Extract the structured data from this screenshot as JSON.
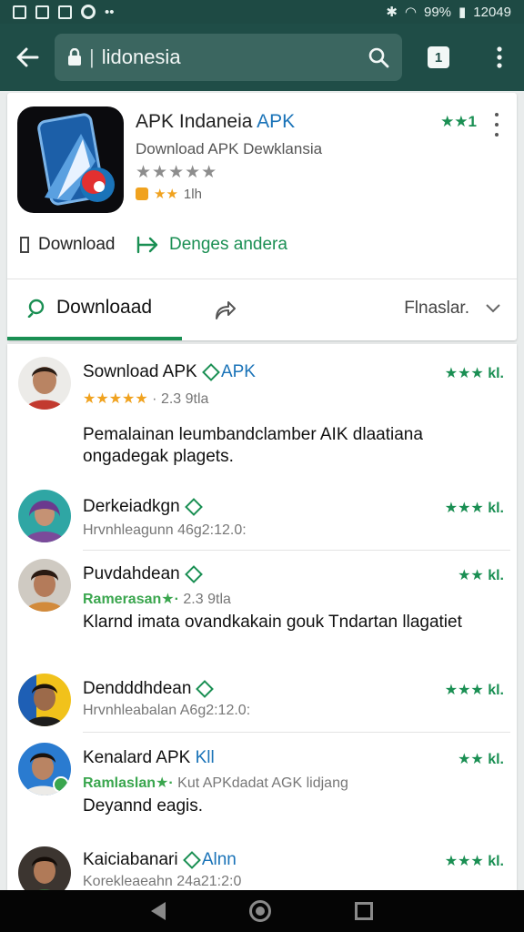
{
  "status": {
    "battery": "99%",
    "time": "12049"
  },
  "appbar": {
    "url": "lidonesia",
    "tab_count": "1"
  },
  "app": {
    "title": "APK Indaneia",
    "title_accent": "APK",
    "subtitle": "Download APK Dewklansia",
    "stars": "★★★★★",
    "installs_text": "1lh",
    "rating_text": "★★1",
    "download_label": "Download",
    "secondary_label": "Denges andera"
  },
  "tabs": {
    "search_label": "Downloaad",
    "filter_label": "Flnaslar."
  },
  "reviews": [
    {
      "name": "Sownload APK",
      "name_accent": "APK",
      "meta_stars": "★★★★★",
      "meta_text": "· 2.3 9tla",
      "text": "Pemalainan leumbandclamber AIK dlaatiana ongadegak plagets.",
      "rating": "★★★ kl."
    },
    {
      "name": "Derkeiadkgn",
      "meta_text": "Hrvnhleagunn 46g2:12.0:",
      "rating": "★★★ kl."
    },
    {
      "name": "Puvdahdean",
      "meta_green": "Ramerasan★·",
      "meta_text": "2.3 9tla",
      "text": "Klarnd imata ovandkakain gouk Tndartan llagatiet",
      "rating": "★★ kl."
    },
    {
      "name": "Dendddhdean",
      "meta_text": "Hrvnhleabalan A6g2:12.0:",
      "rating": "★★★ kl."
    },
    {
      "name": "Kenalard APK",
      "name_accent": "Kll",
      "meta_green": "Ramlaslan★·",
      "meta_text": "Kut APKdadat AGK lidjang",
      "text": "Deyannd eagis.",
      "rating": "★★ kl."
    },
    {
      "name": "Kaiciabanari",
      "name_accent": "Alnn",
      "meta_text": "Korekleaeahn 24a21:2:0",
      "rating": "★★★ kl."
    }
  ]
}
